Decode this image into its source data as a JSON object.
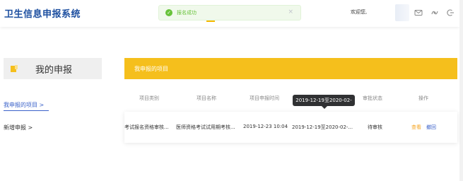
{
  "app": {
    "title": "卫生信息申报系统"
  },
  "toast": {
    "message": "报名成功",
    "close_symbol": "×",
    "color": "#67c23a"
  },
  "header": {
    "welcome": "欢迎您,",
    "icons": [
      "mail-icon",
      "settings-icon",
      "logout-icon"
    ]
  },
  "sidebar": {
    "title": "我的申报",
    "items": [
      {
        "label": "我申报的项目 >",
        "active": true
      },
      {
        "label": "新增申报 >",
        "active": false
      }
    ]
  },
  "panel": {
    "title": "我申报的项目",
    "accent": "#f5bf1c"
  },
  "table": {
    "columns": [
      "项目类别",
      "项目名称",
      "项目申报时间",
      "审批状态",
      "操作"
    ],
    "rows": [
      {
        "category": "考试报名资格审核...",
        "name": "医师资格考试试用期考核...",
        "apply_time": "2019-12-23 10:04",
        "period": "2019-12-19至2020-02-...",
        "status": "待审核",
        "action_view": "查看",
        "action_undo": "撤回"
      }
    ]
  },
  "tooltip": {
    "text": "2019-12-19至2020-02-24"
  }
}
